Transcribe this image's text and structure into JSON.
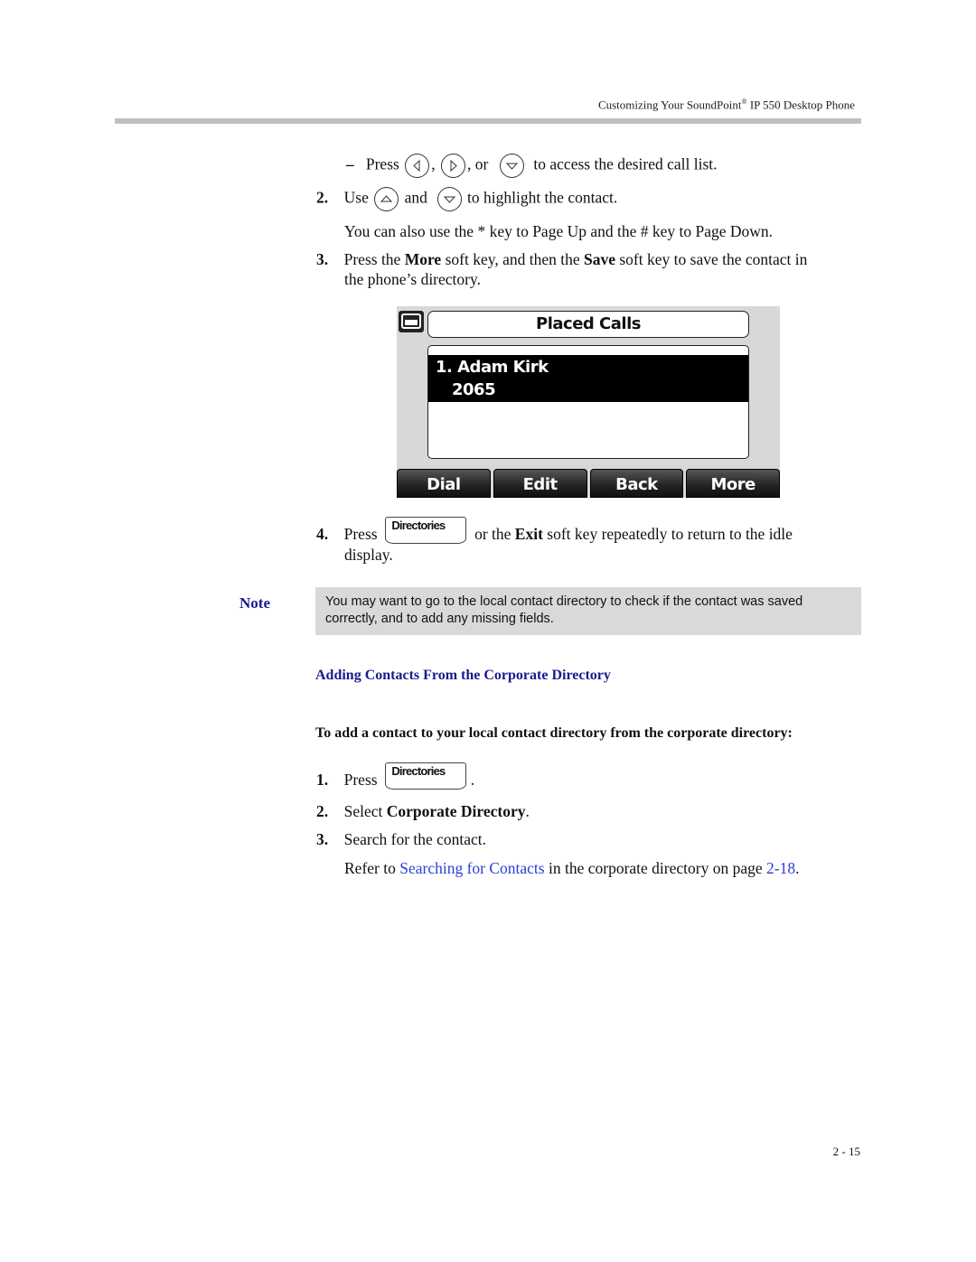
{
  "header": {
    "running_title_pre": "Customizing Your SoundPoint",
    "running_title_sup": "®",
    "running_title_post": " IP 550 Desktop Phone"
  },
  "steps_top": {
    "dash_line": {
      "bullet": "–",
      "pre": "Press",
      "sep1": ",",
      "sep2": ", or",
      "post": "to access the desired call list.",
      "icons": [
        "left-arrow-key-icon",
        "right-arrow-key-icon",
        "down-arrow-key-icon"
      ]
    },
    "step2": {
      "num": "2.",
      "pre": "Use",
      "mid": "and",
      "post": "to highlight the contact.",
      "icons": [
        "up-arrow-key-icon",
        "down-arrow-key-icon"
      ]
    },
    "step2_extra": "You can also use the * key to Page Up and the # key to Page Down.",
    "step3": {
      "num": "3.",
      "t1": "Press the ",
      "b1": "More",
      "t2": " soft key, and then the ",
      "b2": "Save",
      "t3": " soft key to save the contact in",
      "line2": "the phone’s directory."
    }
  },
  "phone_screen": {
    "title": "Placed Calls",
    "entry_name": "1. Adam Kirk",
    "entry_number": "2065",
    "softkeys": [
      "Dial",
      "Edit",
      "Back",
      "More"
    ]
  },
  "step4": {
    "num": "4.",
    "pre": "Press",
    "key": "Directories",
    "t1": "or the ",
    "b1": "Exit",
    "t2": " soft key repeatedly to return to the idle",
    "line2": "display."
  },
  "note": {
    "label": "Note",
    "line1": "You may want to go to the local contact directory to check if the contact was saved",
    "line2": "correctly, and to add any missing fields."
  },
  "section": {
    "heading": "Adding Contacts From the Corporate Directory",
    "procedure_title": "To add a contact to your local contact directory from the corporate directory:",
    "step1": {
      "num": "1.",
      "pre": "Press",
      "key": "Directories",
      "post": "."
    },
    "step2": {
      "num": "2.",
      "pre": "Select ",
      "bold": "Corporate Directory",
      "post": "."
    },
    "step3": {
      "num": "3.",
      "text": "Search for the contact."
    },
    "refer": {
      "pre": "Refer to ",
      "link": "Searching for Contacts",
      "mid": " in the corporate directory on page ",
      "page_link": "2-18",
      "post": "."
    }
  },
  "footer": {
    "page_number": "2 - 15"
  },
  "colors": {
    "heading": "#1a1a8c",
    "link": "#2a3fd6",
    "note_bg": "#d9d9d9"
  }
}
